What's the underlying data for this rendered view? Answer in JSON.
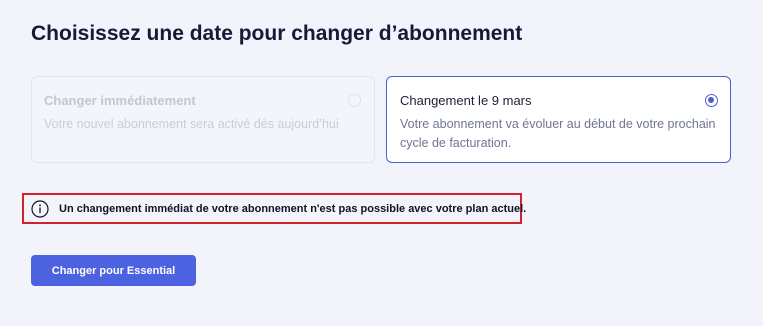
{
  "page": {
    "title": "Choisissez une date pour changer d’abonnement"
  },
  "options": [
    {
      "title": "Changer immédiatement",
      "description": "Votre nouvel abonnement sera activé dès aujourd’hui",
      "state": "disabled",
      "selected": false
    },
    {
      "title": "Changement le 9 mars",
      "description": "Votre abonnement va évoluer au début de votre prochain cycle de facturation.",
      "state": "enabled",
      "selected": true
    }
  ],
  "notice": {
    "icon": "info-icon",
    "text": "Un changement immédiat de votre abonnement n'est pas possible avec votre plan actuel.",
    "border_color": "#d0212d"
  },
  "cta": {
    "label": "Changer pour Essential"
  },
  "colors": {
    "background": "#f2f3fb",
    "accent": "#4c62e0",
    "title": "#161a34"
  }
}
